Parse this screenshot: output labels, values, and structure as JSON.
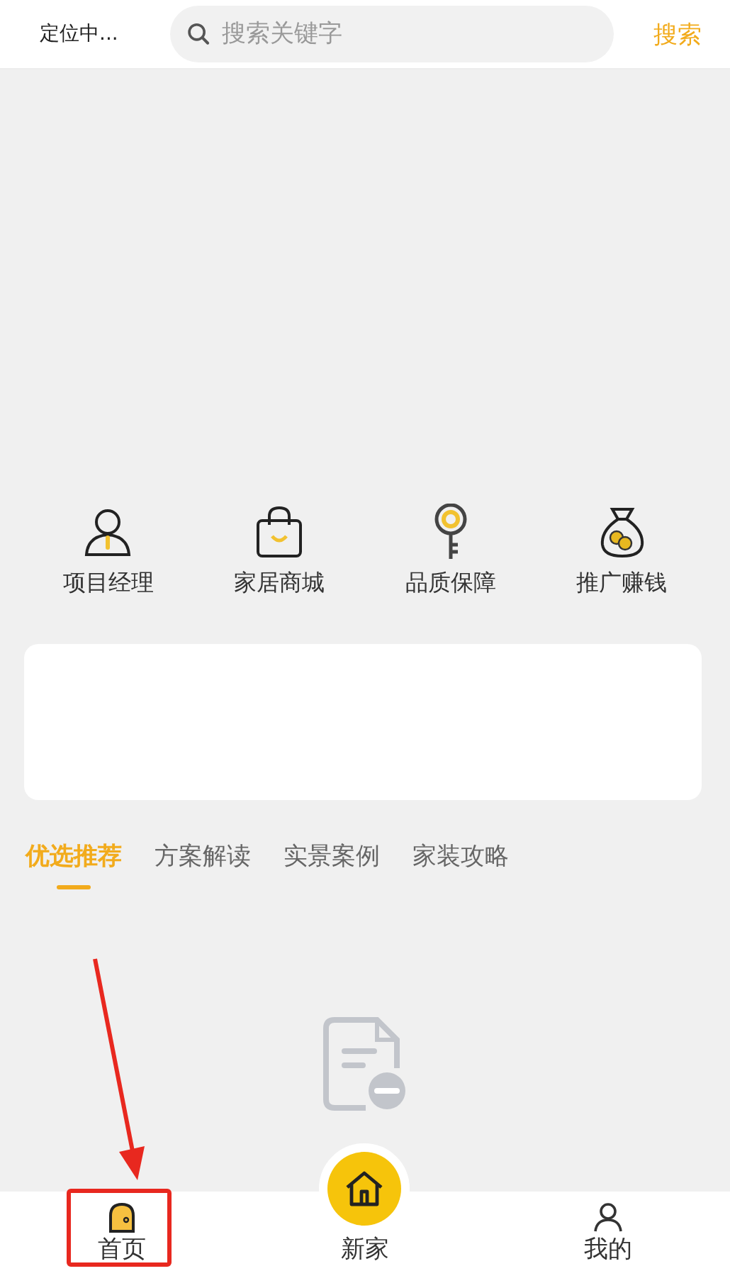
{
  "header": {
    "location": "定位中...",
    "search": {
      "placeholder": "搜索关键字"
    },
    "search_button": "搜索"
  },
  "shortcuts": [
    {
      "kind": "manager",
      "label": "项目经理"
    },
    {
      "kind": "shop",
      "label": "家居商城"
    },
    {
      "kind": "quality",
      "label": "品质保障"
    },
    {
      "kind": "promote",
      "label": "推广赚钱"
    }
  ],
  "tabs": [
    {
      "label": "优选推荐",
      "selected": true
    },
    {
      "label": "方案解读",
      "selected": false
    },
    {
      "label": "实景案例",
      "selected": false
    },
    {
      "label": "家装攻略",
      "selected": false
    }
  ],
  "bottom_nav": [
    {
      "kind": "home",
      "label": "首页",
      "selected": true
    },
    {
      "kind": "center",
      "label": "新家",
      "selected": false
    },
    {
      "kind": "me",
      "label": "我的",
      "selected": false
    }
  ]
}
